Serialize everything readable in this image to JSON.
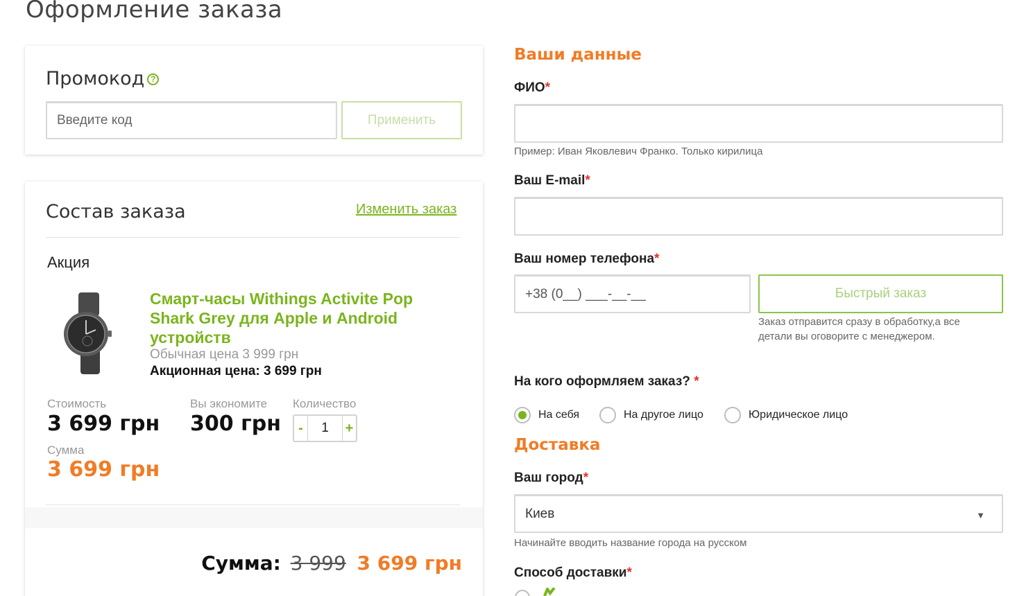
{
  "page": {
    "title": "Оформление заказа"
  },
  "promo": {
    "title": "Промокод",
    "help_icon": "?",
    "placeholder": "Введите код",
    "apply_label": "Применить"
  },
  "order": {
    "title": "Состав заказа",
    "change_link": "Изменить заказ",
    "promo_label": "Акция",
    "product": {
      "name": "Смарт-часы Withings Activite Pop Shark Grey для Apple и Android устройств",
      "regular_price": "Обычная цена 3 999 грн",
      "sale_price": "Акционная цена: 3 699 грн"
    },
    "cost_label": "Стоимость",
    "cost_value": "3 699 грн",
    "savings_label": "Вы экономите",
    "savings_value": "300 грн",
    "quantity_label": "Количество",
    "quantity_minus": "-",
    "quantity_value": "1",
    "quantity_plus": "+",
    "sum_label": "Сумма",
    "sum_value": "3 699 грн",
    "total_label": "Сумма:",
    "total_old": "3 999",
    "total_new": "3 699 грн"
  },
  "customer": {
    "heading": "Ваши данные",
    "required_mark": "*",
    "name_label": "ФИО",
    "name_hint": "Пример: Иван Яковлевич Франко. Только кирилица",
    "email_label": "Ваш E-mail",
    "phone_label": "Ваш номер телефона",
    "phone_placeholder": "+38 (0__) ___-__-__",
    "quick_order_label": "Быстрый заказ",
    "quick_order_hint_1": "Заказ отправится сразу в обработку,а все",
    "quick_order_hint_2": "детали вы оговорите с менеджером.",
    "recipient_label": "На кого оформляем заказ?",
    "recipient_options": [
      "На себя",
      "На другое лицо",
      "Юридическое лицо"
    ],
    "recipient_selected": 0
  },
  "delivery": {
    "heading": "Доставка",
    "city_label": "Ваш город",
    "city_value": "Киев",
    "city_hint": "Начинайте вводить название города на русском",
    "method_label": "Способ доставки"
  },
  "colors": {
    "accent_green": "#7ab51d",
    "accent_orange": "#f07c26",
    "required_red": "#e0322b"
  }
}
